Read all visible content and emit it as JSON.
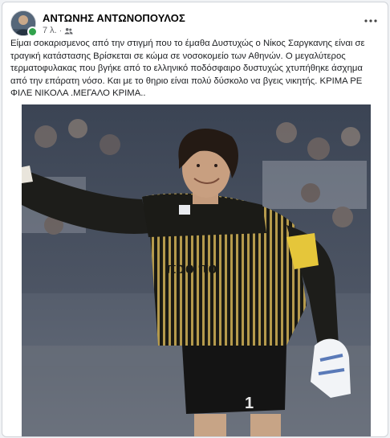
{
  "post": {
    "author": "ΑΝΤΩΝΗΣ ΑΝΤΩΝΟΠΟΥΛΟΣ",
    "time": "7 λ.",
    "separator": "·",
    "audience_icon": "friends-icon",
    "more_icon": "more-options-icon",
    "text": "Είμαι σοκαρισμενος από την στιγμή που το έμαθα Δυστυχώς ο Νίκος Σαργκανης είναι σε τραγική κατάστασης Βρίσκεται σε κώμα σε νοσοκομείο των Αθηνών. Ο μεγαλύτερος τερματοφυλακας που βγήκε από το ελληνικό ποδόσφαιρο δυστυχώς  χτυπήθηκε άσχημα από την επάρατη νόσο. Και με το θηριο είναι πολύ δύσκολο να βγεις νικητής. ΚΡΙΜΑ ΡΕ ΦΙΛΕ ΝΙΚΟΛΑ .ΜΕΓΑΛΟ ΚΡΙΜΑ..",
    "photo": {
      "jersey_text": "προ πο",
      "shorts_number": "1"
    }
  },
  "colors": {
    "accent_presence": "#31a24c",
    "text_primary": "#050505",
    "text_secondary": "#65676b"
  }
}
